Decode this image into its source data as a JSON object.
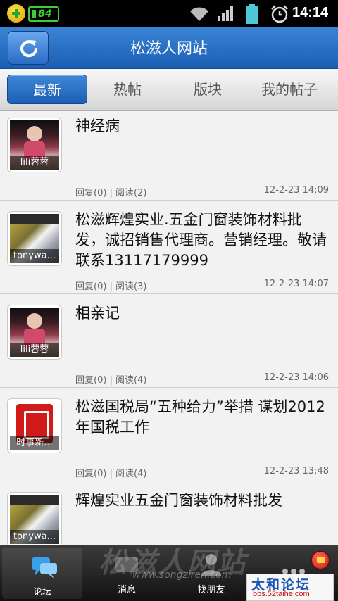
{
  "status_bar": {
    "time": "14:14",
    "battery_badge": "84",
    "icons": [
      "app-plus-icon",
      "battery-saver-icon",
      "wifi-icon",
      "signal-icon",
      "battery-icon",
      "alarm-icon"
    ]
  },
  "header": {
    "title": "松滋人网站",
    "refresh_icon": "refresh-icon"
  },
  "tabs": [
    {
      "label": "最新",
      "active": true
    },
    {
      "label": "热帖",
      "active": false
    },
    {
      "label": "版块",
      "active": false
    },
    {
      "label": "我的帖子",
      "active": false
    }
  ],
  "posts": [
    {
      "author": "lili蓉蓉",
      "title": "神经病",
      "stats": "回复(0) | 阅读(2)",
      "time": "12-2-23 14:09"
    },
    {
      "author": "tonywa...",
      "title": "松滋辉煌实业.五金门窗装饰材料批发，诚招销售代理商。营销经理。敬请联系13117179999",
      "stats": "回复(0) | 阅读(3)",
      "time": "12-2-23 14:07"
    },
    {
      "author": "lili蓉蓉",
      "title": "相亲记",
      "stats": "回复(0) | 阅读(4)",
      "time": "12-2-23 14:06"
    },
    {
      "author": "时事新...",
      "title": "松滋国税局“五种给力”举措 谋划2012年国税工作",
      "stats": "回复(0) | 阅读(4)",
      "time": "12-2-23 13:48"
    },
    {
      "author": "tonywa...",
      "title": "辉煌实业五金门窗装饰材料批发",
      "stats": "",
      "time": ""
    }
  ],
  "bottom_nav": [
    {
      "label": "论坛",
      "icon": "forum-chat-icon",
      "active": true
    },
    {
      "label": "消息",
      "icon": "message-icon",
      "active": false
    },
    {
      "label": "找朋友",
      "icon": "find-friends-icon",
      "active": false
    }
  ],
  "watermark": {
    "text": "松滋人网站",
    "url": "www.songziren.com"
  },
  "logo": {
    "name": "太和论坛",
    "url": "bbs.52taihe.com"
  },
  "colors": {
    "accent_blue": "#1c5fb3",
    "status_green": "#3ccf3c",
    "notification_red": "#c11a12"
  }
}
